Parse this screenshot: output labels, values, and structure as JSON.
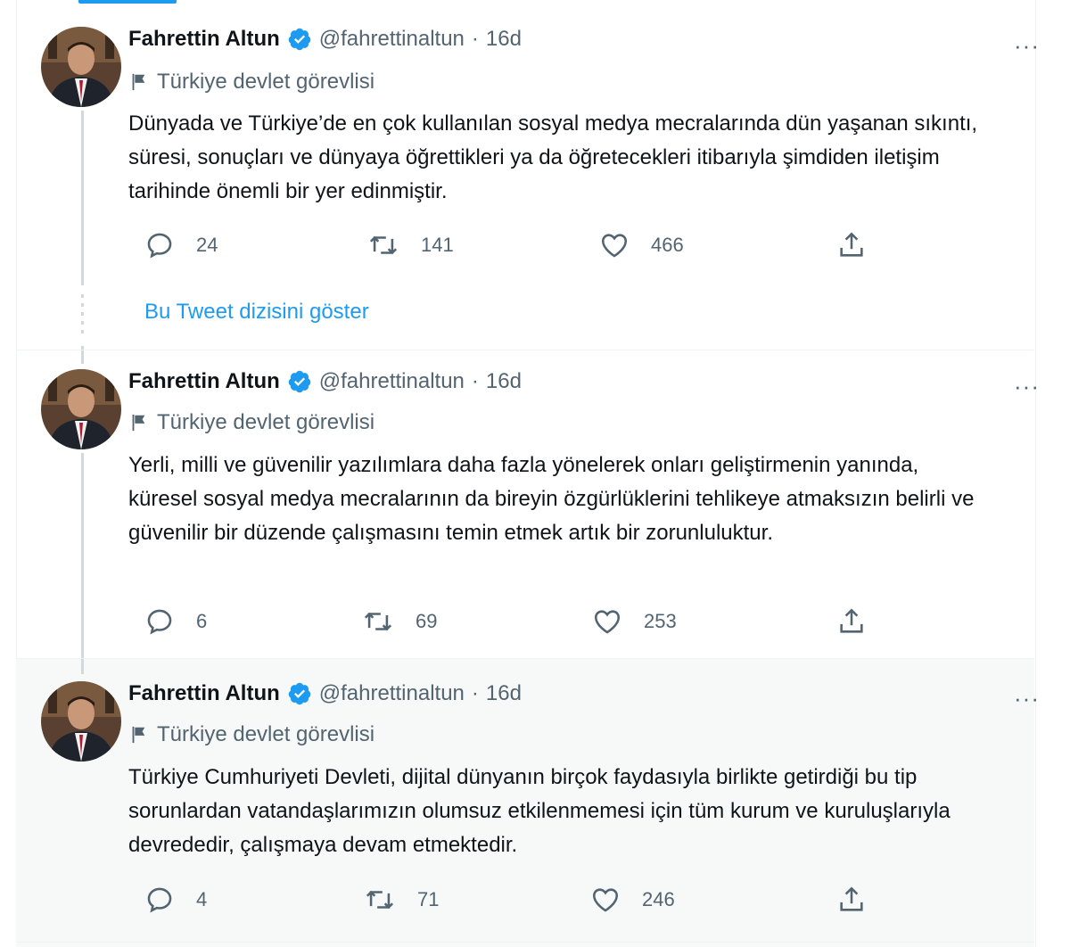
{
  "accent_color": "#1d9bf0",
  "show_thread_label": "Bu Tweet dizisini göster",
  "tweets": [
    {
      "author_name": "Fahrettin Altun",
      "handle": "@fahrettinaltun",
      "separator": "·",
      "time": "16d",
      "more_label": "···",
      "gov_label": "Türkiye devlet görevlisi",
      "text": "Dünyada ve Türkiye’de en çok kullanılan sosyal medya mecralarında dün yaşanan sıkıntı, süresi, sonuçları ve dünyaya öğrettikleri ya da öğretecekleri itibarıyla şimdiden iletişim tarihinde önemli bir yer edinmiştir.",
      "replies": "24",
      "retweets": "141",
      "likes": "466",
      "icons": {
        "reply": "reply-icon",
        "retweet": "retweet-icon",
        "like": "heart-icon",
        "share": "share-icon",
        "verified": "verified-badge-icon",
        "flag": "flag-icon"
      }
    },
    {
      "author_name": "Fahrettin Altun",
      "handle": "@fahrettinaltun",
      "separator": "·",
      "time": "16d",
      "more_label": "···",
      "gov_label": "Türkiye devlet görevlisi",
      "text": "Yerli, milli ve güvenilir yazılımlara daha fazla yönelerek onları geliştirmenin yanında, küresel sosyal medya mecralarının da bireyin özgürlüklerini tehlikeye atmaksızın belirli ve güvenilir bir düzende çalışmasını temin etmek artık bir zorunluluktur.",
      "replies": "6",
      "retweets": "69",
      "likes": "253"
    },
    {
      "author_name": "Fahrettin Altun",
      "handle": "@fahrettinaltun",
      "separator": "·",
      "time": "16d",
      "more_label": "···",
      "gov_label": "Türkiye devlet görevlisi",
      "text": "Türkiye Cumhuriyeti Devleti, dijital dünyanın birçok faydasıyla birlikte getirdiği bu tip sorunlardan vatandaşlarımızın olumsuz etkilenmemesi için tüm kurum ve kuruluşlarıyla devrededir, çalışmaya devam etmektedir.",
      "replies": "4",
      "retweets": "71",
      "likes": "246"
    }
  ]
}
